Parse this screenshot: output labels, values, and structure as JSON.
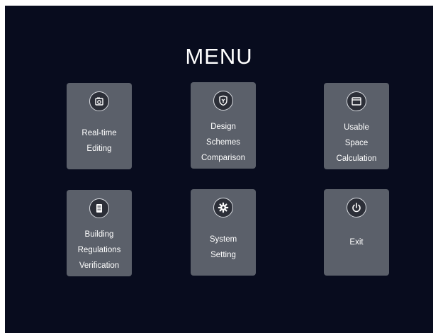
{
  "menu": {
    "title": "MENU",
    "items": [
      {
        "lines": [
          "Real-time",
          "Editing"
        ],
        "icon": "camera-icon"
      },
      {
        "lines": [
          "Design",
          "Schemes",
          "Comparison"
        ],
        "icon": "shield-icon"
      },
      {
        "lines": [
          "Usable",
          "Space",
          "Calculation"
        ],
        "icon": "window-icon"
      },
      {
        "lines": [
          "Building",
          "Regulations",
          "Verification"
        ],
        "icon": "document-icon"
      },
      {
        "lines": [
          "System",
          "Setting"
        ],
        "icon": "gear-icon"
      },
      {
        "lines": [
          "Exit"
        ],
        "icon": "power-icon"
      }
    ]
  },
  "colors": {
    "background": "#080c1e",
    "tile": "#5b606a",
    "text": "#ffffff"
  }
}
